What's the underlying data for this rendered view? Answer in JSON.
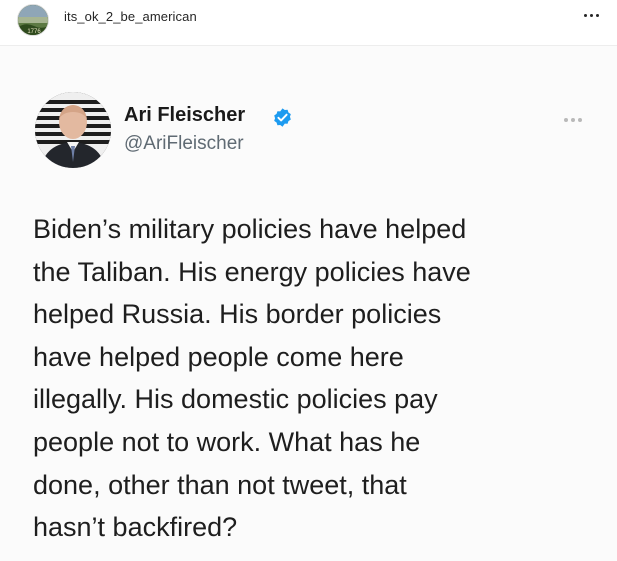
{
  "post": {
    "username": "its_ok_2_be_american",
    "avatar_icon": "profile-picture",
    "more_icon": "more-options-icon"
  },
  "tweet": {
    "author_name": "Ari Fleischer",
    "handle": "@AriFleischer",
    "verified_icon": "verified-badge-icon",
    "verified_color": "#1d9bf0",
    "lines": [
      "Biden’s military policies have helped",
      "the Taliban. His energy policies have",
      "helped Russia. His border policies",
      "have helped people come here",
      "illegally. His domestic policies pay",
      "people not to work. What has he",
      "done, other than not tweet, that",
      "hasn’t backfired?"
    ]
  }
}
